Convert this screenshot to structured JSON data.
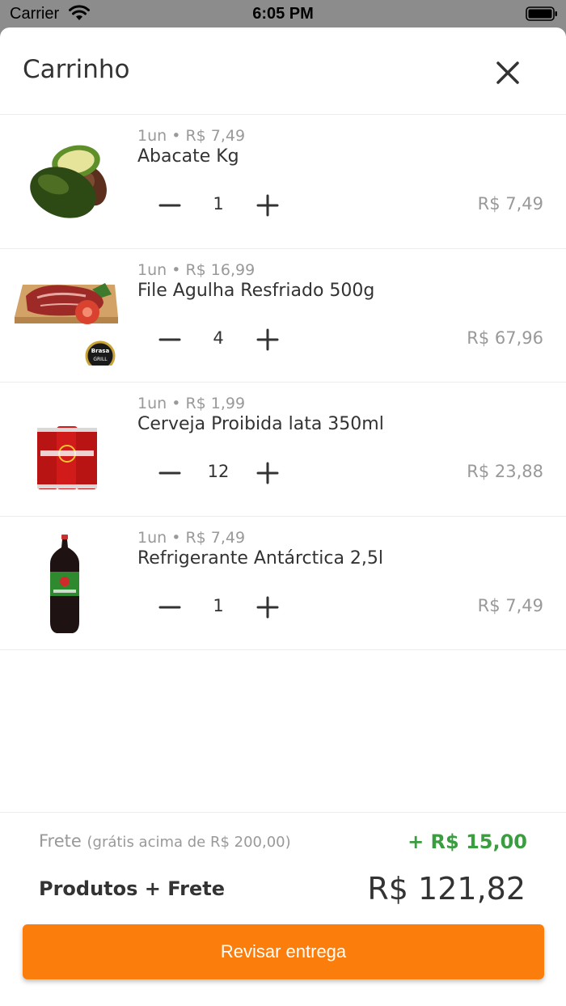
{
  "status_bar": {
    "carrier": "Carrier",
    "time": "6:05 PM"
  },
  "header": {
    "title": "Carrinho"
  },
  "items": [
    {
      "unit_price": "1un • R$ 7,49",
      "name": "Abacate Kg",
      "qty": "1",
      "total": "R$ 7,49",
      "image": "avocado"
    },
    {
      "unit_price": "1un • R$ 16,99",
      "name": "File Agulha Resfriado 500g",
      "qty": "4",
      "total": "R$ 67,96",
      "image": "steak"
    },
    {
      "unit_price": "1un • R$ 1,99",
      "name": "Cerveja Proibida lata 350ml",
      "qty": "12",
      "total": "R$ 23,88",
      "image": "beer-cans"
    },
    {
      "unit_price": "1un • R$ 7,49",
      "name": "Refrigerante Antárctica 2,5l",
      "qty": "1",
      "total": "R$ 7,49",
      "image": "soda-bottle"
    }
  ],
  "footer": {
    "frete_label": "Frete",
    "frete_note": "(grátis acima de R$ 200,00)",
    "frete_value": "+ R$ 15,00",
    "total_label": "Produtos + Frete",
    "total_value": "R$ 121,82",
    "cta_label": "Revisar entrega"
  },
  "colors": {
    "accent": "#fb7d0b",
    "frete": "#3a9d3f"
  }
}
